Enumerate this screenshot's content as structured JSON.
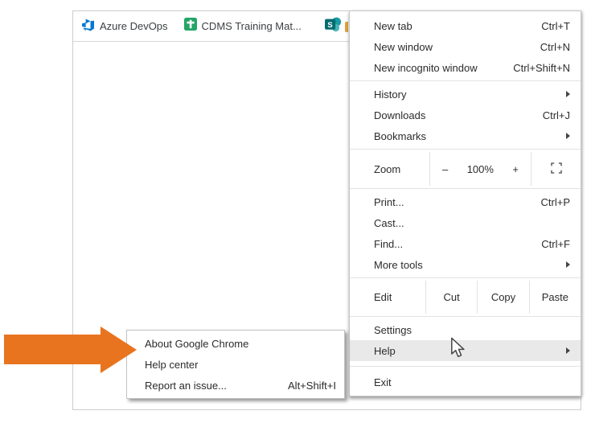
{
  "colors": {
    "accent_orange": "#e87420",
    "menu_highlight": "#e9e9ea",
    "azure_blue": "#0078d4",
    "cdms_green": "#23a566",
    "sharepoint_teal_dark": "#036c70",
    "sharepoint_teal_light": "#1a9ba1"
  },
  "icons": {
    "bookmark_icons": [
      "azure-devops-icon",
      "cdms-icon",
      "sharepoint-icon"
    ],
    "menu_icons": [
      "fullscreen-icon",
      "submenu-arrow-icon"
    ],
    "annotations": [
      "orange-arrow",
      "mouse-cursor-icon"
    ]
  },
  "bookmarks_bar": {
    "items": [
      {
        "label": "Azure DevOps"
      },
      {
        "label": "CDMS Training Mat..."
      },
      {
        "label": ""
      }
    ],
    "sharepoint_letter": "S"
  },
  "menu": {
    "items": [
      {
        "label": "New tab",
        "shortcut": "Ctrl+T"
      },
      {
        "label": "New window",
        "shortcut": "Ctrl+N"
      },
      {
        "label": "New incognito window",
        "shortcut": "Ctrl+Shift+N"
      },
      {
        "label": "History"
      },
      {
        "label": "Downloads",
        "shortcut": "Ctrl+J"
      },
      {
        "label": "Bookmarks"
      },
      {
        "label": "Print...",
        "shortcut": "Ctrl+P"
      },
      {
        "label": "Cast..."
      },
      {
        "label": "Find...",
        "shortcut": "Ctrl+F"
      },
      {
        "label": "More tools"
      },
      {
        "label": "Settings"
      },
      {
        "label": "Help"
      },
      {
        "label": "Exit"
      }
    ],
    "zoom_row": {
      "label": "Zoom",
      "minus": "–",
      "value": "100%",
      "plus": "+"
    },
    "edit_row": {
      "label": "Edit",
      "cut": "Cut",
      "copy": "Copy",
      "paste": "Paste"
    }
  },
  "help_submenu": {
    "items": [
      {
        "label": "About Google Chrome"
      },
      {
        "label": "Help center"
      },
      {
        "label": "Report an issue...",
        "shortcut": "Alt+Shift+I"
      }
    ]
  }
}
